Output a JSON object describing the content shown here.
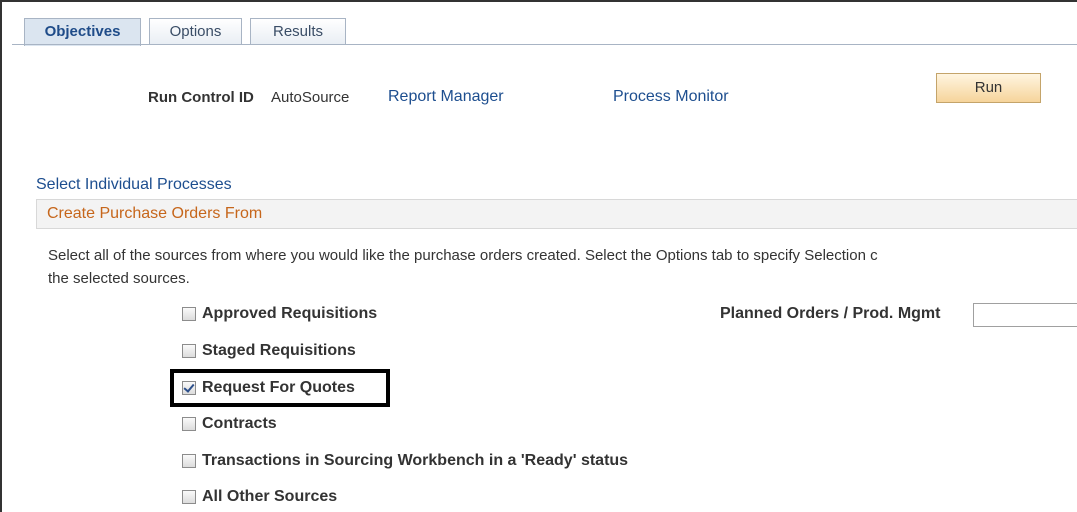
{
  "tabs": [
    {
      "label": "Objectives",
      "active": true
    },
    {
      "label": "Options",
      "active": false
    },
    {
      "label": "Results",
      "active": false
    }
  ],
  "header": {
    "run_control_label": "Run Control ID",
    "run_control_value": "AutoSource",
    "report_manager_link": "Report Manager",
    "process_monitor_link": "Process Monitor",
    "run_button": "Run"
  },
  "select_processes_link": "Select Individual Processes",
  "section": {
    "title": "Create Purchase Orders From",
    "description_line1": "Select all of the sources from where you would like the purchase orders created. Select the Options tab to specify Selection c",
    "description_line2": "the selected sources."
  },
  "sources": [
    {
      "label": "Approved Requisitions",
      "checked": false
    },
    {
      "label": "Staged Requisitions",
      "checked": false
    },
    {
      "label": "Request For Quotes",
      "checked": true
    },
    {
      "label": "Contracts",
      "checked": false
    },
    {
      "label": "Transactions in Sourcing Workbench in a 'Ready' status",
      "checked": false
    },
    {
      "label": "All Other Sources",
      "checked": false
    }
  ],
  "planned_orders": {
    "label": "Planned Orders / Prod. Mgmt",
    "value": ""
  },
  "colors": {
    "link": "#1d4e8f",
    "section_title": "#c6661b",
    "run_button": "#f6d49b",
    "highlight_border": "#000000"
  }
}
